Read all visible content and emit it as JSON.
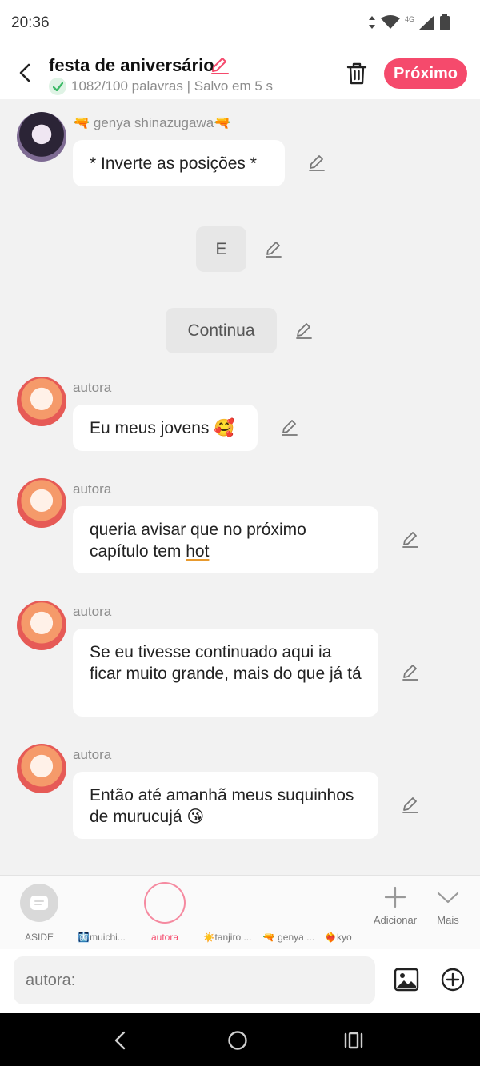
{
  "status_bar": {
    "time": "20:36",
    "network": "4G"
  },
  "header": {
    "title": "festa de aniversário",
    "subtitle": "1082/100 palavras | Salvo em 5 s",
    "next_label": "Próximo"
  },
  "messages": [
    {
      "type": "character",
      "name": "🔫 genya shinazugawa🔫",
      "avatar": "genya",
      "text": "* Inverte as posições *"
    },
    {
      "type": "narration",
      "text": "E"
    },
    {
      "type": "narration",
      "text": "Continua"
    },
    {
      "type": "character",
      "name": "autora",
      "avatar": "autora",
      "text": "Eu meus jovens 🥰"
    },
    {
      "type": "character",
      "name": "autora",
      "avatar": "autora",
      "text_before": "queria avisar que no próximo capítulo tem ",
      "text_underlined": "hot"
    },
    {
      "type": "character",
      "name": "autora",
      "avatar": "autora",
      "text": "Se eu tivesse continuado aqui ia ficar muito grande, mais do que já tá"
    },
    {
      "type": "character",
      "name": "autora",
      "avatar": "autora",
      "text": "Então até amanhã meus suquinhos de murucujá 😘"
    }
  ],
  "characters": [
    {
      "label": "ASIDE",
      "avatar": "aside",
      "active": false
    },
    {
      "label": "🩻muichi...",
      "avatar": "giyuu",
      "active": false
    },
    {
      "label": "autora",
      "avatar": "autora",
      "active": true
    },
    {
      "label": "☀️tanjiro ...",
      "avatar": "tanjiro",
      "active": false
    },
    {
      "label": "🔫 genya ...",
      "avatar": "genya",
      "active": false
    },
    {
      "label": "❤️‍🔥kyo",
      "avatar": "kyo",
      "active": false
    }
  ],
  "tools": {
    "add_label": "Adicionar",
    "more_label": "Mais"
  },
  "input": {
    "placeholder": "autora:"
  },
  "colors": {
    "accent": "#f54a6c",
    "check": "#3cba67"
  }
}
